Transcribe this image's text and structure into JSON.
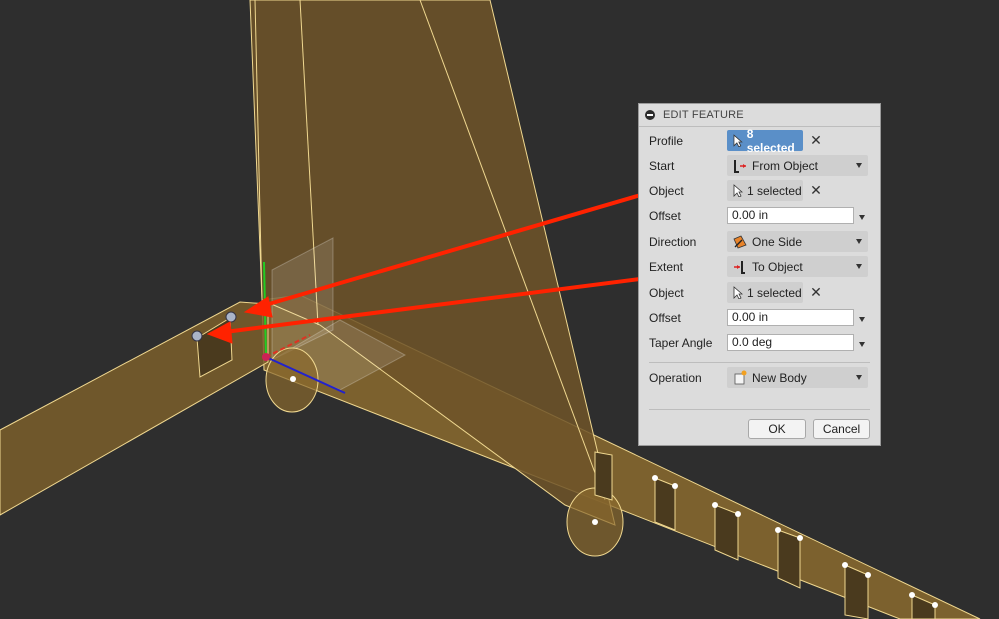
{
  "dialog": {
    "title": "EDIT FEATURE",
    "rows": {
      "profile": {
        "label": "Profile",
        "value": "8 selected"
      },
      "start": {
        "label": "Start",
        "value": "From Object"
      },
      "start_object": {
        "label": "Object",
        "value": "1 selected"
      },
      "offset1": {
        "label": "Offset",
        "value": "0.00 in"
      },
      "direction": {
        "label": "Direction",
        "value": "One Side"
      },
      "extent": {
        "label": "Extent",
        "value": "To Object"
      },
      "extent_object": {
        "label": "Object",
        "value": "1 selected"
      },
      "offset2": {
        "label": "Offset",
        "value": "0.00 in"
      },
      "taper": {
        "label": "Taper Angle",
        "value": "0.0 deg"
      },
      "operation": {
        "label": "Operation",
        "value": "New Body"
      }
    },
    "ok_label": "OK",
    "cancel_label": "Cancel"
  },
  "colors": {
    "background": "#2e2e2e",
    "body_fill": "#8a6a2e",
    "edge": "#f0d890",
    "annotation_arrow": "#ff2200",
    "selected_blue": "#5a8fc8"
  },
  "icons": [
    "select-cursor-icon",
    "from-object-icon",
    "one-side-icon",
    "to-object-icon",
    "new-body-icon",
    "clear-x-icon",
    "collapse-icon"
  ]
}
